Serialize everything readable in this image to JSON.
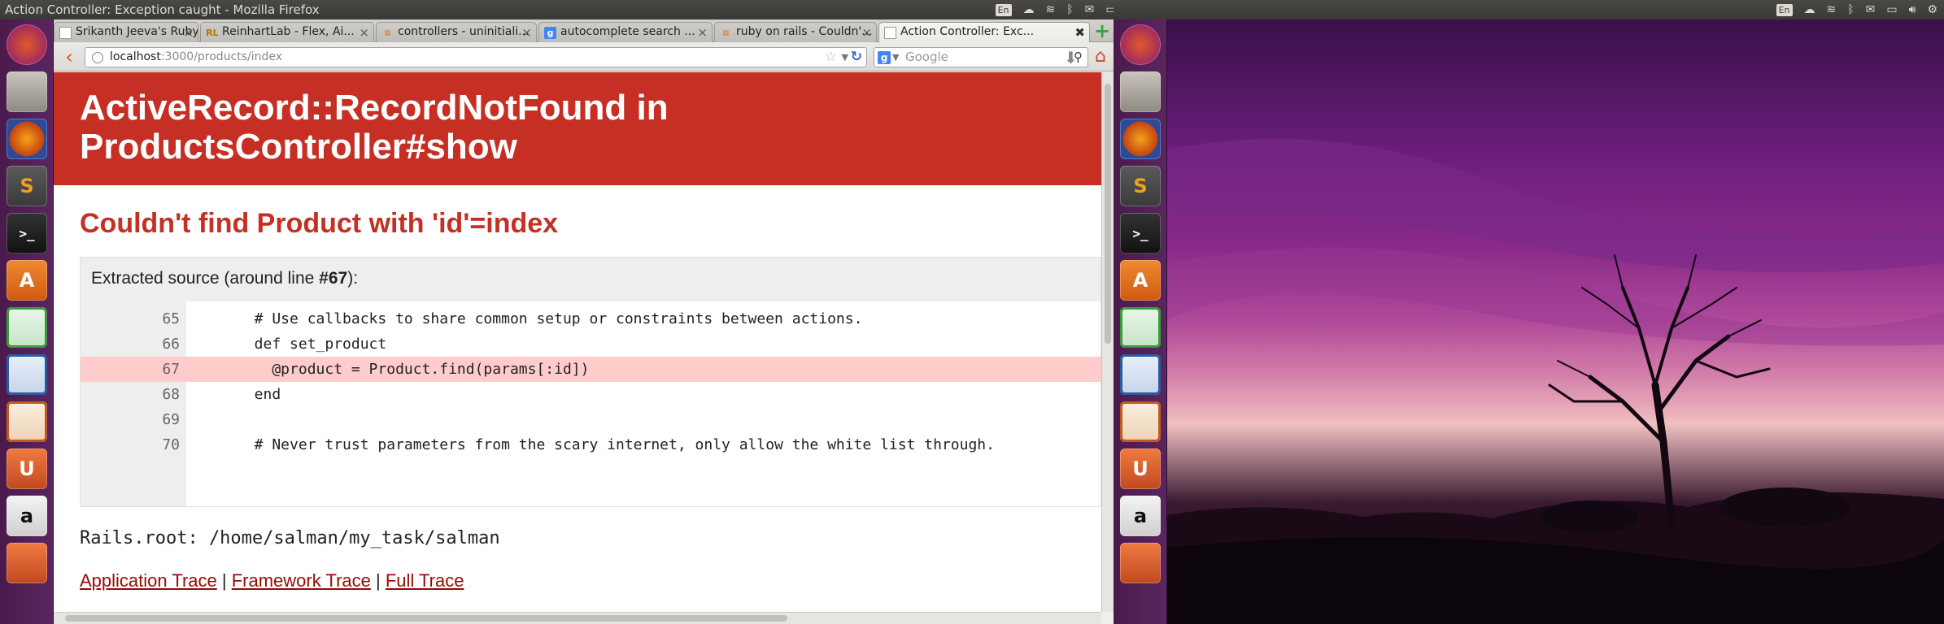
{
  "window": {
    "title": "Action Controller: Exception caught - Mozilla Firefox"
  },
  "indicators": {
    "keyboard": "En"
  },
  "tabs": [
    {
      "label": "Srikanth Jeeva's Ruby ...",
      "favicon": "page-icon",
      "active": false
    },
    {
      "label": "ReinhartLab - Flex, Ai...",
      "favicon": "RL",
      "active": false
    },
    {
      "label": "controllers - uninitiali...",
      "favicon": "stackoverflow-icon",
      "active": false
    },
    {
      "label": "autocomplete search ...",
      "favicon": "g",
      "active": false
    },
    {
      "label": "ruby on rails - Couldn'...",
      "favicon": "stackoverflow-icon",
      "active": false
    },
    {
      "label": "Action Controller: Exc...",
      "favicon": "page-icon",
      "active": true
    }
  ],
  "nav": {
    "url_host": "localhost",
    "url_rest": ":3000/products/index",
    "search_placeholder": "Google"
  },
  "error": {
    "title": "ActiveRecord::RecordNotFound in ProductsController#show",
    "title_line1": "ActiveRecord::RecordNotFound in",
    "title_line2": "ProductsController#show",
    "message": "Couldn't find Product with 'id'=index",
    "source_prefix": "Extracted source (around line ",
    "source_line": "#67",
    "source_suffix": "):",
    "code": [
      {
        "num": "65",
        "text": "  # Use callbacks to share common setup or constraints between actions.",
        "highlight": false
      },
      {
        "num": "66",
        "text": "  def set_product",
        "highlight": false
      },
      {
        "num": "67",
        "text": "    @product = Product.find(params[:id])",
        "highlight": true
      },
      {
        "num": "68",
        "text": "  end",
        "highlight": false
      },
      {
        "num": "69",
        "text": "",
        "highlight": false
      },
      {
        "num": "70",
        "text": "  # Never trust parameters from the scary internet, only allow the white list through.",
        "highlight": false
      }
    ],
    "rails_root": "Rails.root: /home/salman/my_task/salman",
    "trace_links": [
      "Application Trace",
      "Framework Trace",
      "Full Trace"
    ],
    "trace_separator": "|"
  },
  "colors": {
    "header_red": "#c52f24",
    "link": "#980905",
    "highlight_line": "#ffcccc",
    "launcher": "#5a2560"
  },
  "launcher_items": [
    {
      "name": "ubuntu-dash-icon",
      "glyph": ""
    },
    {
      "name": "files-icon",
      "glyph": ""
    },
    {
      "name": "firefox-icon",
      "glyph": ""
    },
    {
      "name": "sublime-text-icon",
      "glyph": "S"
    },
    {
      "name": "terminal-icon",
      "glyph": ">_"
    },
    {
      "name": "software-center-icon",
      "glyph": "A"
    },
    {
      "name": "calc-spreadsheet-icon",
      "glyph": ""
    },
    {
      "name": "writer-document-icon",
      "glyph": ""
    },
    {
      "name": "impress-presentation-icon",
      "glyph": ""
    },
    {
      "name": "ubuntu-one-icon",
      "glyph": "U"
    },
    {
      "name": "amazon-icon",
      "glyph": "a"
    },
    {
      "name": "updates-icon",
      "glyph": ""
    }
  ]
}
